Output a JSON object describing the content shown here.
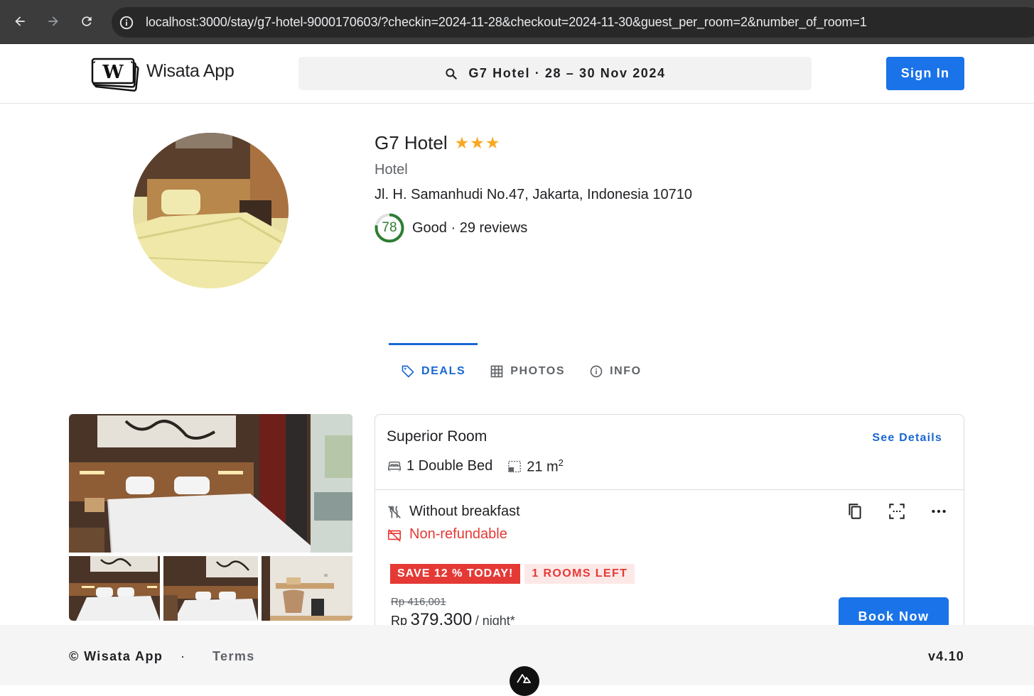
{
  "browser": {
    "url": "localhost:3000/stay/g7-hotel-9000170603/?checkin=2024-11-28&checkout=2024-11-30&guest_per_room=2&number_of_room=1"
  },
  "header": {
    "brand": "Wisata App",
    "search_query": "G7 Hotel · 28 – 30 Nov 2024",
    "sign_in_label": "Sign In"
  },
  "hotel": {
    "name": "G7 Hotel",
    "stars": "★★★",
    "star_count": 3,
    "type": "Hotel",
    "address": "Jl. H. Samanhudi No.47, Jakarta, Indonesia 10710",
    "rating_score": "78",
    "rating_fraction": 0.78,
    "rating_text": "Good · 29 reviews"
  },
  "tabs": [
    {
      "label": "DEALS",
      "icon": "tag-icon",
      "active": true
    },
    {
      "label": "PHOTOS",
      "icon": "grid-icon",
      "active": false
    },
    {
      "label": "INFO",
      "icon": "info-icon",
      "active": false
    }
  ],
  "room": {
    "title": "Superior Room",
    "see_details": "See Details",
    "bed": "1 Double Bed",
    "size": "21 m",
    "size_unit_sup": "2",
    "meal": "Without breakfast",
    "refund": "Non-refundable",
    "save_badge": "SAVE 12 % TODAY!",
    "rooms_left_badge": "1 ROOMS LEFT",
    "old_price": "Rp 416,001",
    "price_currency": "Rp",
    "price_amount": "379,300",
    "price_unit": "/ night*",
    "book_label": "Book Now"
  },
  "footer": {
    "copyright": "© Wisata App",
    "separator": "·",
    "terms": "Terms",
    "version": "v4.10"
  },
  "colors": {
    "primary": "#1a73e8",
    "accent_blue": "#1967d2",
    "danger": "#e53935",
    "rating_green": "#2e7d32",
    "star_gold": "#f9a825"
  }
}
